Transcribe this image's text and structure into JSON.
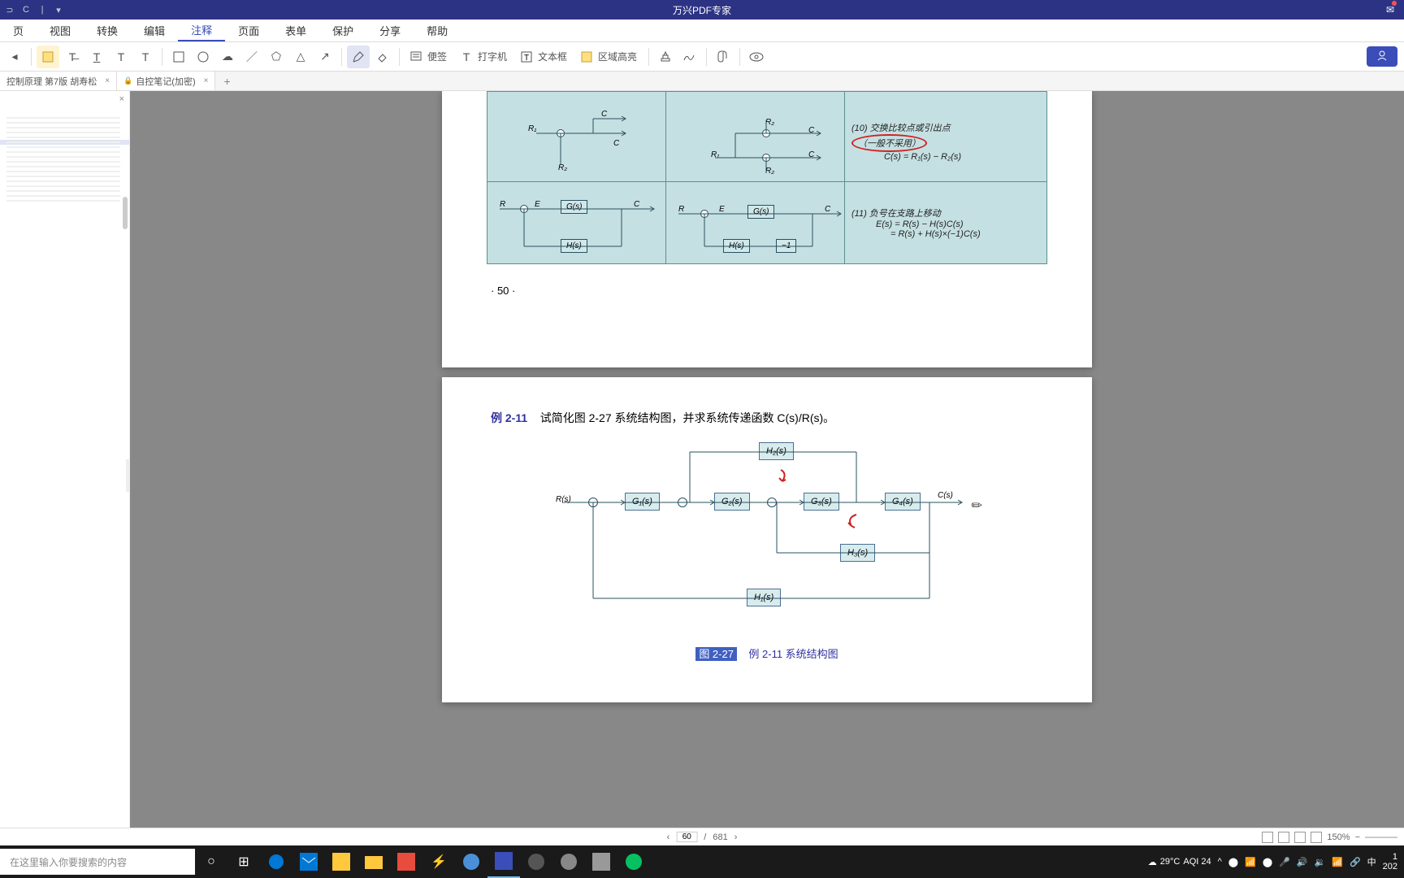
{
  "titlebar": {
    "title": "万兴PDF专家"
  },
  "menu": {
    "items": [
      "页",
      "视图",
      "转换",
      "编辑",
      "注释",
      "页面",
      "表单",
      "保护",
      "分享",
      "帮助"
    ],
    "active_index": 4
  },
  "toolbar": {
    "sticky_note": "便签",
    "typewriter": "打字机",
    "text_box": "文本框",
    "area_highlight": "区域高亮"
  },
  "tabs": {
    "items": [
      {
        "label": "控制原理  第7版 胡寿松",
        "locked": false
      },
      {
        "label": "自控笔记(加密)",
        "locked": true
      }
    ]
  },
  "page50": {
    "row1_desc": "(10) 交换比较点或引出点",
    "row1_note": "（一般不采用）",
    "row1_formula": "C(s) = R₁(s) − R₂(s)",
    "row2_desc": "(11) 负号在支路上移动",
    "row2_formula1": "E(s) = R(s) − H(s)C(s)",
    "row2_formula2": "= R(s) + H(s)×(−1)C(s)",
    "labels": {
      "r1": "R₁",
      "r2": "R₂",
      "c": "C",
      "r": "R",
      "e": "E",
      "gs": "G(s)",
      "hs": "H(s)",
      "minus1": "−1"
    },
    "page_num": "· 50 ·"
  },
  "page51": {
    "example_num": "例 2-11",
    "example_text": "试简化图 2-27 系统结构图，并求系统传递函数 C(s)/R(s)。",
    "blocks": {
      "g1": "G₁(s)",
      "g2": "G₂(s)",
      "g3": "G₃(s)",
      "g4": "G₄(s)",
      "h1": "H₁(s)",
      "h2": "H₂(s)",
      "h3": "H₃(s)"
    },
    "signals": {
      "rs": "R(s)",
      "cs": "C(s)"
    },
    "fig_num": "图 2-27",
    "fig_caption": "例 2-11 系统结构图"
  },
  "statusbar": {
    "current_page": "60",
    "total_pages": "681",
    "zoom": "150%"
  },
  "taskbar": {
    "search_placeholder": "在这里输入你要搜索的内容",
    "weather_temp": "29°C",
    "weather_aqi": "AQI 24",
    "ime": "中",
    "year": "202"
  }
}
